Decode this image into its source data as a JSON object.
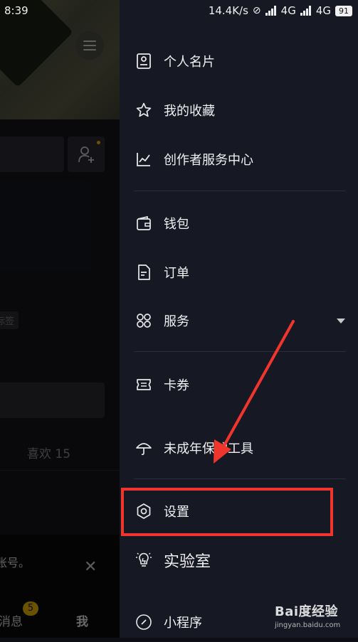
{
  "status_bar": {
    "time": "8:39",
    "net_speed": "14.4K/s",
    "network_1": "4G",
    "network_2": "4G",
    "battery": "91"
  },
  "profile_bg": {
    "likes_label": "喜欢 15",
    "tag_text": "标签",
    "toast_text": "账号。",
    "nav_messages": "消息",
    "nav_messages_badge": "5",
    "nav_me": "我"
  },
  "drawer": {
    "items": [
      {
        "label": "个人名片",
        "icon": "contact-card-icon"
      },
      {
        "label": "我的收藏",
        "icon": "star-icon"
      },
      {
        "label": "创作者服务中心",
        "icon": "chart-line-icon"
      },
      {
        "label": "钱包",
        "icon": "wallet-icon"
      },
      {
        "label": "订单",
        "icon": "order-document-icon"
      },
      {
        "label": "服务",
        "icon": "services-grid-icon"
      },
      {
        "label": "卡券",
        "icon": "coupon-icon"
      },
      {
        "label": "未成年保护工具",
        "icon": "umbrella-icon"
      },
      {
        "label": "设置",
        "icon": "gear-icon"
      },
      {
        "label": "实验室",
        "icon": "lightbulb-icon"
      },
      {
        "label": "小程序",
        "icon": "link-icon"
      }
    ]
  },
  "annotation": {
    "highlight_color": "#f0362c",
    "arrow_color": "#f0362c"
  },
  "watermark": {
    "title": "Bai度经验",
    "subtitle": "jingyan.baidu.com"
  }
}
